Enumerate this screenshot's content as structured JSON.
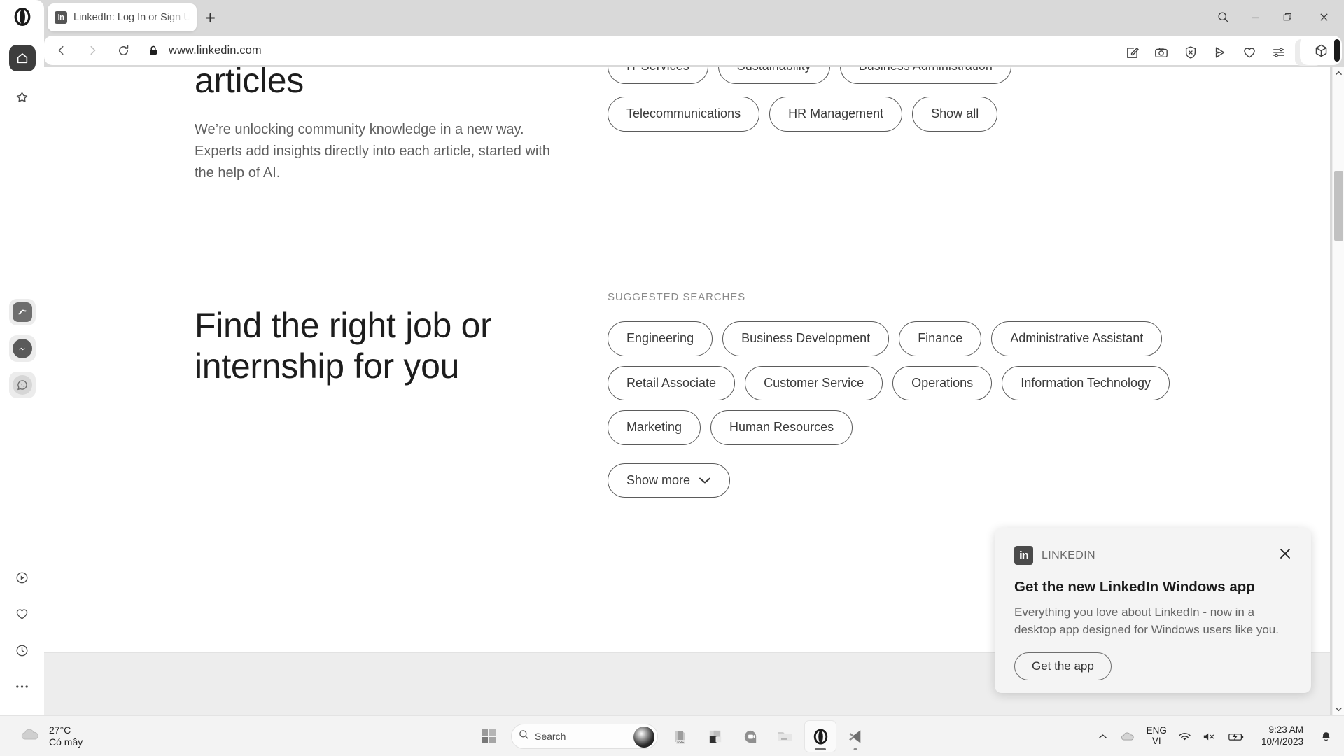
{
  "browser": {
    "name": "Opera",
    "tab": {
      "title": "LinkedIn: Log In or Sign U",
      "favicon_label": "in"
    },
    "new_tab_label": "+",
    "window_controls": [
      "search-icon",
      "minimize-icon",
      "restore-icon",
      "close-icon"
    ],
    "address": {
      "url": "www.linkedin.com",
      "secure": true
    },
    "toolbar_icons": [
      "note-edit-icon",
      "snapshot-camera-icon",
      "ad-block-shield-icon",
      "send-icon",
      "heart-icon",
      "easy-setup-icon",
      "profile-icon"
    ],
    "extension_icon": "cube-icon",
    "sidebar_top": [
      "home-icon",
      "favorites-star-icon"
    ],
    "sidebar_apps": [
      "aria-icon",
      "messenger-icon",
      "whatsapp-icon"
    ],
    "sidebar_bottom": [
      "player-icon",
      "heart-icon",
      "history-clock-icon",
      "more-dots-icon"
    ]
  },
  "page": {
    "top_chips_clipped": [
      "IT Services",
      "Sustainability",
      "Business Administration"
    ],
    "chips_row2": [
      "Telecommunications",
      "HR Management",
      "Show all"
    ],
    "articles": {
      "heading": "articles",
      "paragraph": "We’re unlocking community knowledge in a new way. Experts add insights directly into each article, started with the help of AI."
    },
    "jobs": {
      "heading_line1": "Find the right job or",
      "heading_line2": "internship for you",
      "section_label": "SUGGESTED SEARCHES",
      "chips": [
        "Engineering",
        "Business Development",
        "Finance",
        "Administrative Assistant",
        "Retail Associate",
        "Customer Service",
        "Operations",
        "Information Technology",
        "Marketing",
        "Human Resources"
      ],
      "show_more_label": "Show more"
    }
  },
  "toast": {
    "brand": "LINKEDIN",
    "badge_label": "in",
    "title": "Get the new LinkedIn Windows app",
    "body": "Everything you love about LinkedIn - now in a desktop app designed for Windows users like you.",
    "cta_label": "Get the app",
    "close_icon": "close-icon"
  },
  "taskbar": {
    "weather": {
      "temperature": "27°C",
      "condition": "Có mây",
      "icon": "cloud-icon"
    },
    "start_icon": "windows-start-icon",
    "search": {
      "placeholder": "Search",
      "icon": "search-icon",
      "orb": "copilot-orb-icon"
    },
    "apps": [
      "office-pre-icon",
      "windows-app-icon",
      "chat-icon",
      "file-explorer-icon",
      "opera-icon",
      "vscode-icon"
    ],
    "tray": {
      "overflow_icon": "chevron-up-icon",
      "onedrive_icon": "cloud-icon",
      "language_primary": "ENG",
      "language_secondary": "VI",
      "wifi_icon": "wifi-icon",
      "volume_icon": "volume-muted-icon",
      "battery_icon": "battery-charging-icon",
      "time": "9:23 AM",
      "date": "10/4/2023",
      "notification_icon": "bell-icon"
    }
  }
}
